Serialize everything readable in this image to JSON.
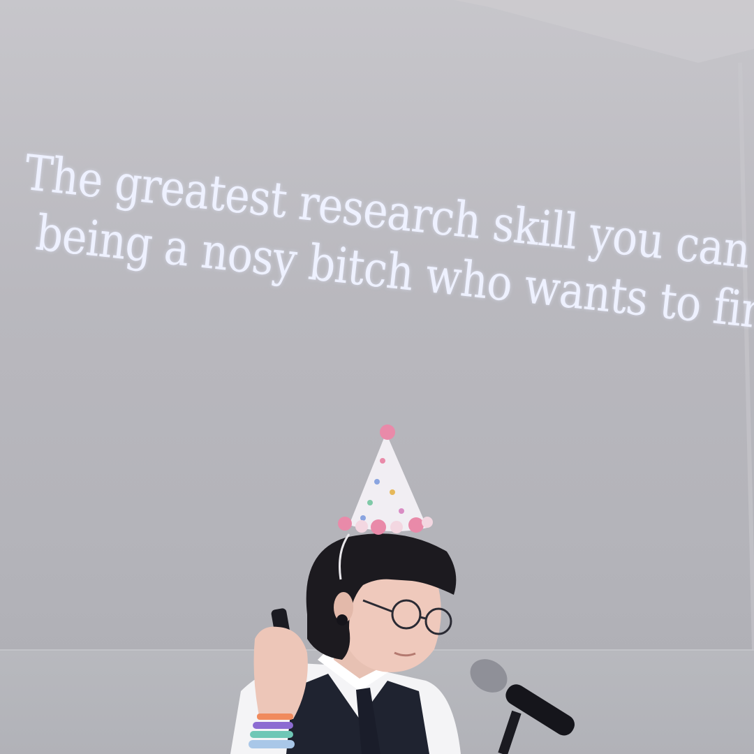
{
  "slide": {
    "lines": [
      "The greatest research skill you can have is",
      "being a nosy bitch who wants to find out"
    ]
  },
  "colors": {
    "projection": "#bdbcc2",
    "slide_text": "#eef1ff",
    "hair": "#1c1a1f",
    "hat": "#f1eef3",
    "pompom": "#e98aa9",
    "vest": "#1f2330",
    "shirt": "#f4f4f6"
  }
}
